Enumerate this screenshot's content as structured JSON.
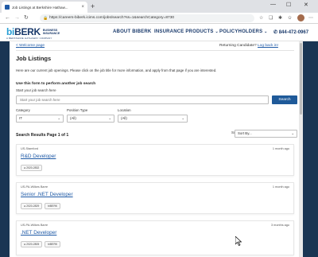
{
  "browser": {
    "tab_title": "Job Listings at Berkshire Hathaw...",
    "tab_close": "×",
    "new_tab": "+",
    "url": "https://careers-biberk.icims.com/jobs/search?ss=1&searchCategory=8730",
    "win_min": "—",
    "win_max": "☐",
    "win_close": "✕"
  },
  "site": {
    "logo_main_left": "bi",
    "logo_main_right": "BERK",
    "logo_sub_1": "BUSINESS",
    "logo_sub_2": "INSURANCE",
    "logo_tag": "A BERKSHIRE HATHAWAY COMPANY",
    "nav": [
      {
        "label": "ABOUT BIBERK"
      },
      {
        "label": "INSURANCE PRODUCTS"
      },
      {
        "label": "POLICYHOLDERS"
      }
    ],
    "phone": "844-472-0967"
  },
  "page": {
    "welcome": "Welcome page",
    "returning_text": "Returning Candidate?",
    "login_link": "Log back in!",
    "title": "Job Listings",
    "intro": "Here are our current job openings. Please click on the job title for more information, and apply from that page if you are interested.",
    "use_form": "Use this form to perform another job search",
    "search_label": "Start your job search here",
    "search_placeholder": "Start your job search here",
    "search_button": "Search",
    "filters": {
      "category": {
        "label": "Category",
        "value": "IT"
      },
      "position_type": {
        "label": "Position Type",
        "value": "(All)"
      },
      "location": {
        "label": "Location",
        "value": "(All)"
      }
    },
    "sort_label": "Sort By",
    "sort_value": "Sort By...",
    "results_heading": "Search Results Page 1 of 1"
  },
  "jobs": [
    {
      "location": "US-Stamford",
      "ago": "1 month ago",
      "title": "R&D Developer",
      "tags": [
        "2020-2832"
      ]
    },
    {
      "location": "US-PA-Wilkes Barre",
      "ago": "1 month ago",
      "title": "Senior .NET Developer",
      "tags": [
        "2020-2829",
        "biBERK"
      ]
    },
    {
      "location": "US-PA-Wilkes Barre",
      "ago": "3 months ago",
      "title": ".NET Developer",
      "tags": [
        "2020-2805",
        "biBERK"
      ]
    }
  ]
}
